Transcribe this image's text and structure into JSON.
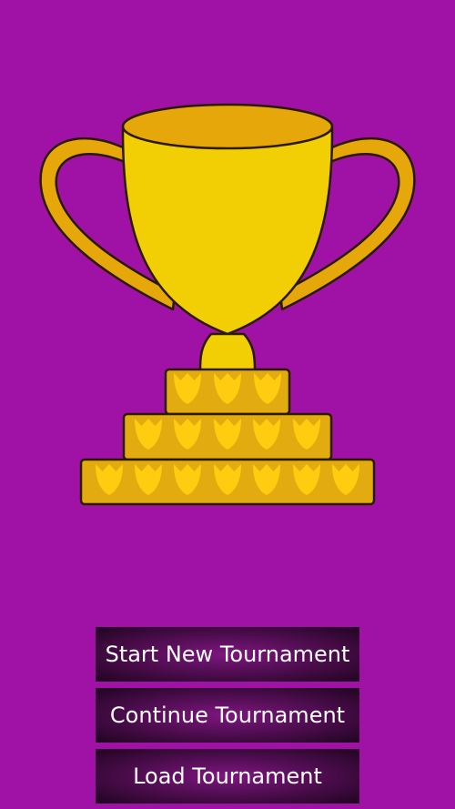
{
  "screen": {
    "background_color": "#a012a5",
    "trophy_icon": "trophy-icon",
    "trophy_colors": {
      "cup": "#f2cf04",
      "rim": "#e6a70a",
      "base": "#e2ac10",
      "emblem": "#ffcc10",
      "outline": "#2a1a00"
    }
  },
  "menu": {
    "start_new_label": "Start New Tournament",
    "continue_label": "Continue Tournament",
    "load_label": "Load Tournament"
  }
}
